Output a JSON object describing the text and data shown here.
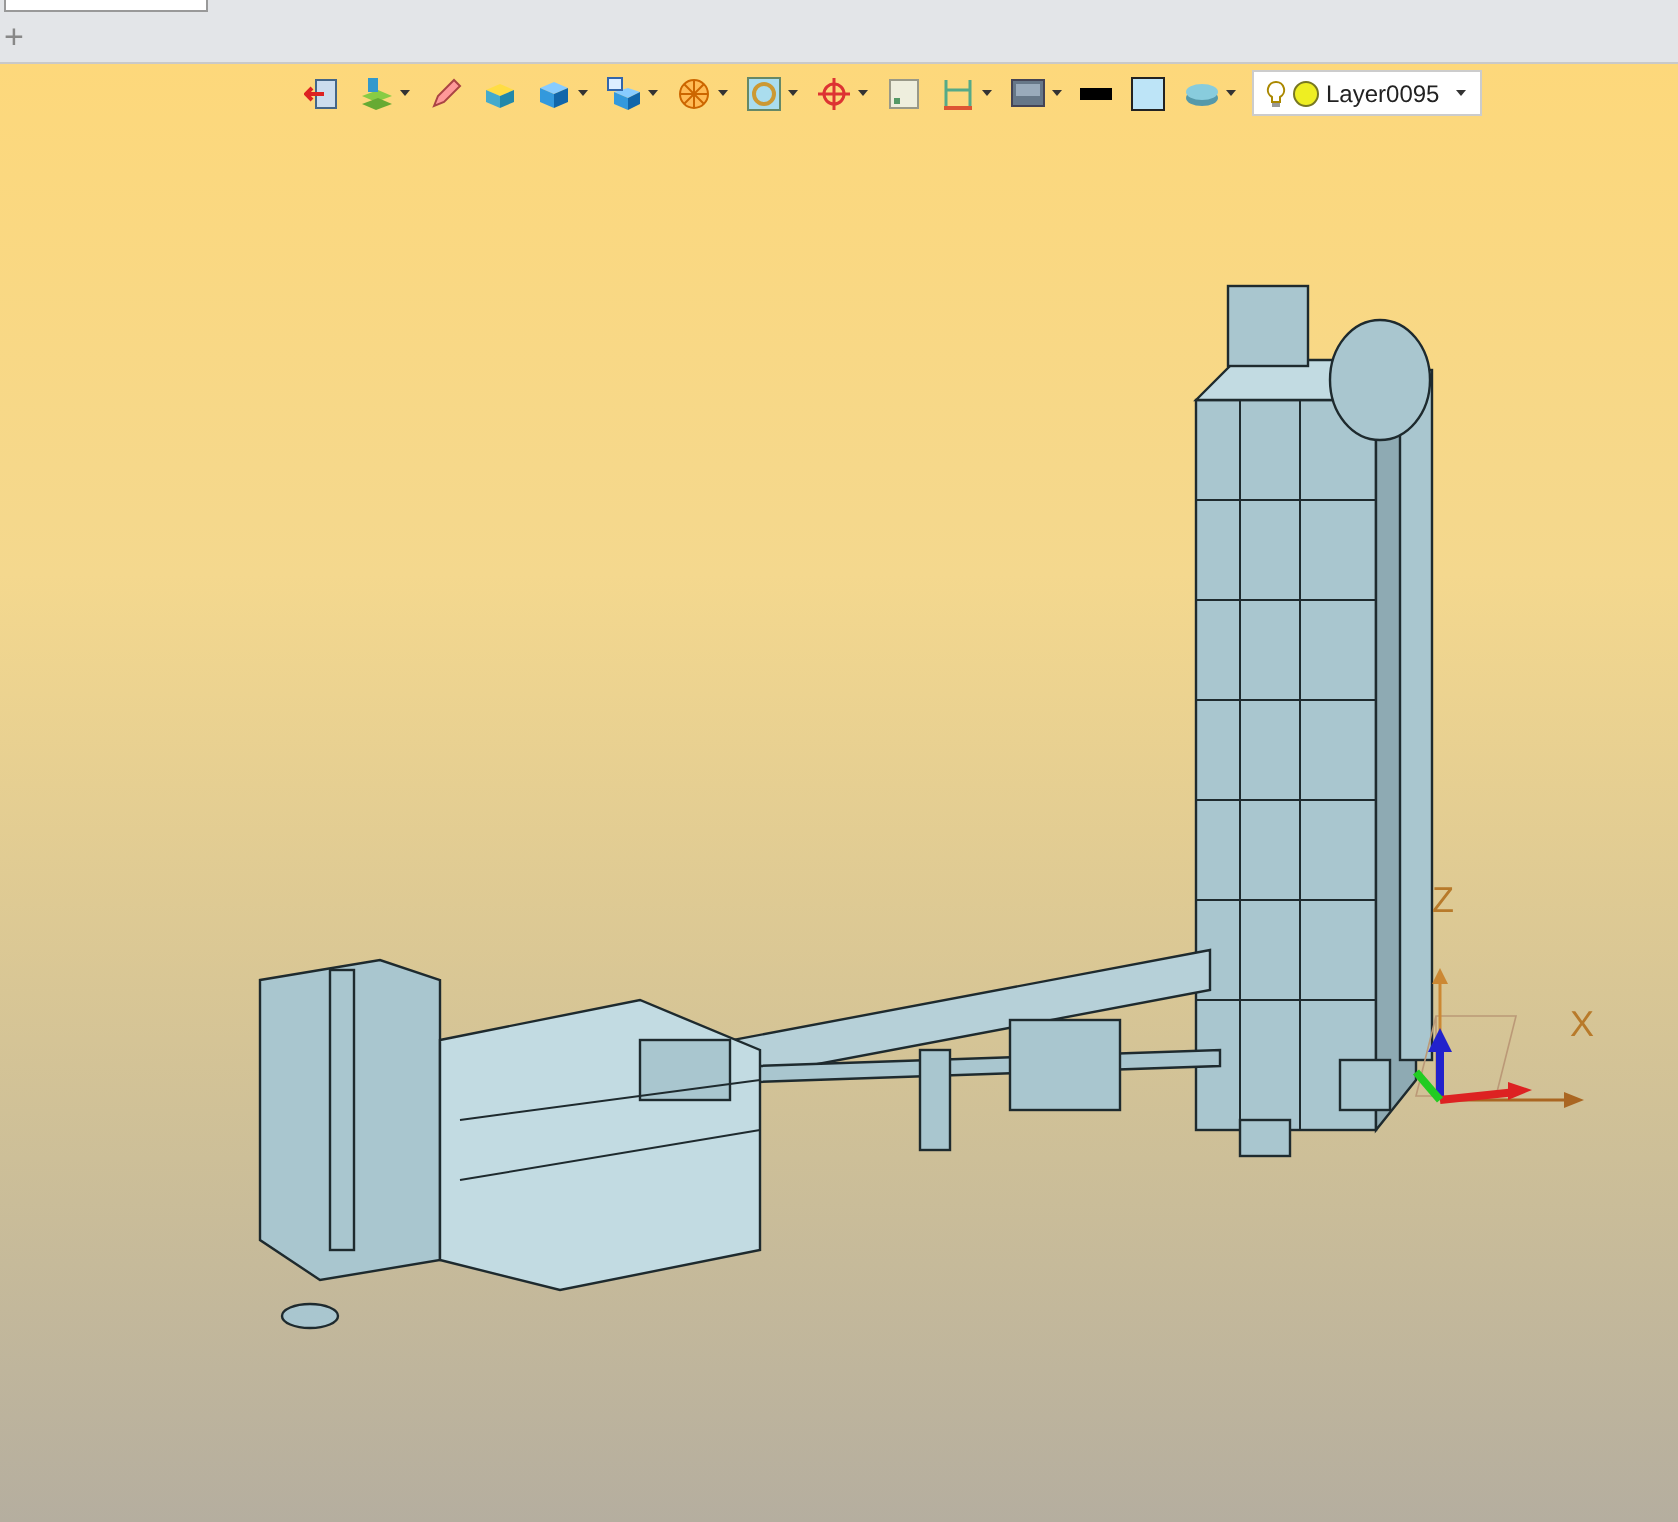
{
  "tab_bar": {
    "add_tab": "+"
  },
  "toolbar": {
    "buttons": [
      {
        "kind": "exit",
        "menu": false
      },
      {
        "kind": "layers",
        "menu": true
      },
      {
        "kind": "pencil",
        "menu": false
      },
      {
        "kind": "box",
        "menu": false
      },
      {
        "kind": "cube",
        "menu": true
      },
      {
        "kind": "view",
        "menu": true
      },
      {
        "kind": "wire",
        "menu": true
      },
      {
        "kind": "frame",
        "menu": true
      },
      {
        "kind": "target",
        "menu": true
      },
      {
        "kind": "square",
        "menu": false
      },
      {
        "kind": "dimension",
        "menu": true
      },
      {
        "kind": "monitor",
        "menu": true
      },
      {
        "kind": "line",
        "menu": false
      },
      {
        "kind": "fill",
        "menu": false
      },
      {
        "kind": "stack",
        "menu": true
      }
    ],
    "layer": {
      "name": "Layer0095"
    }
  },
  "axes": {
    "z": "Z",
    "x": "X"
  }
}
